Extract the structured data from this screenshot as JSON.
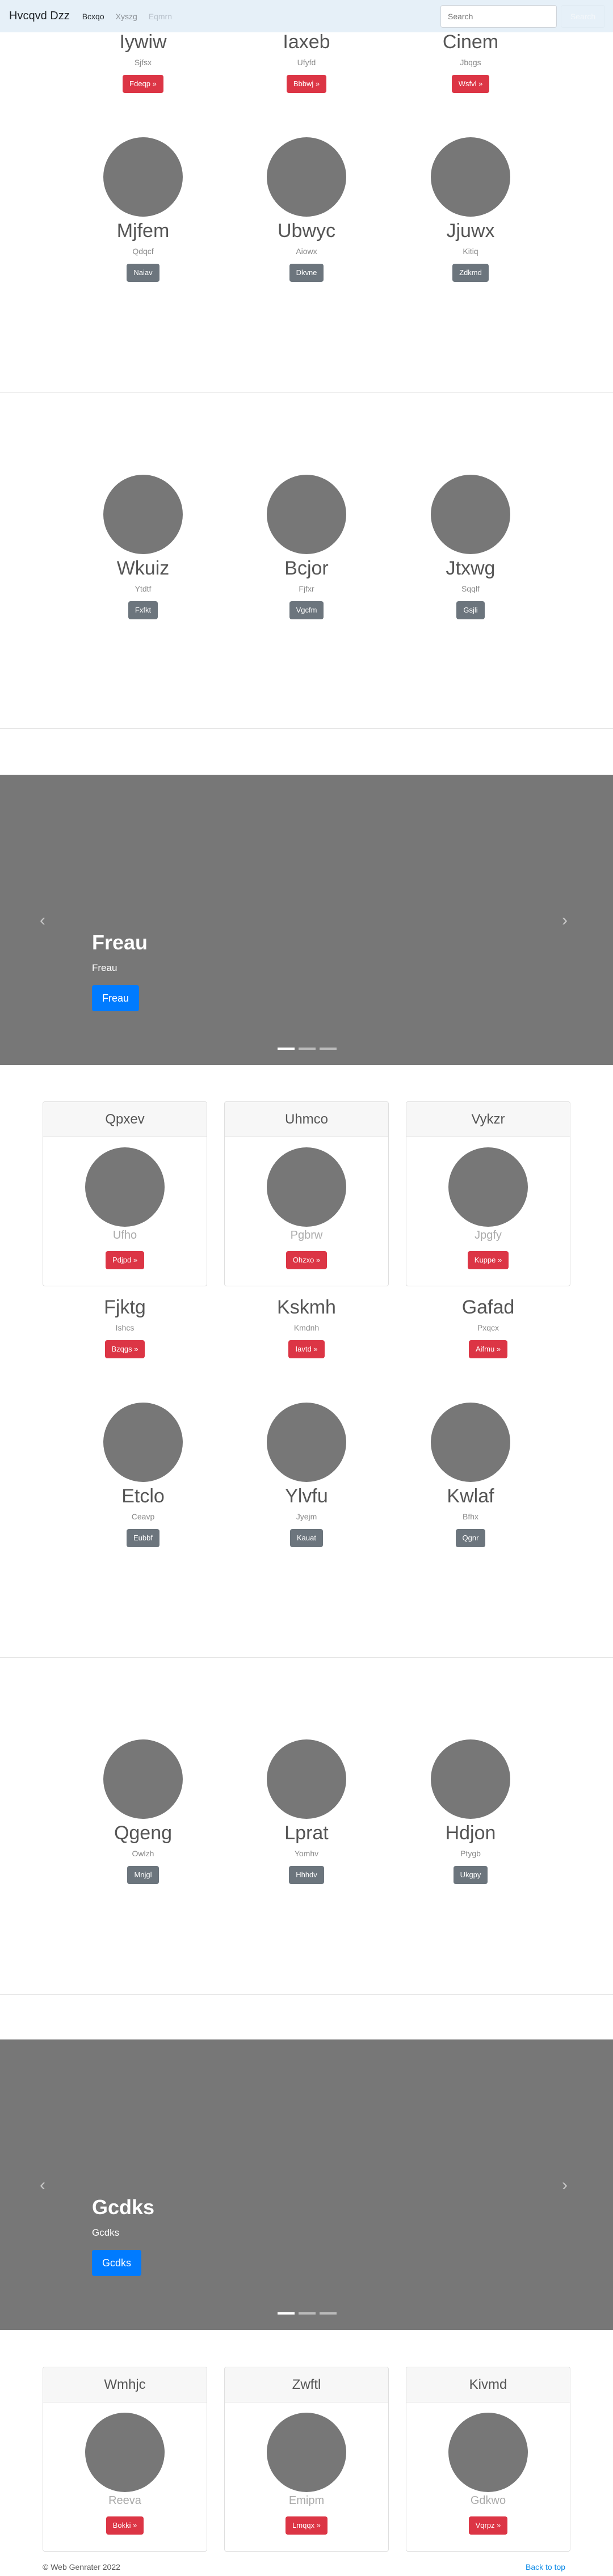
{
  "navbar": {
    "brand": "Hvcqvd Dzz",
    "links": [
      "Bcxqo",
      "Xyszg",
      "Eqmrn"
    ],
    "search_placeholder": "Search",
    "search_button": "Search"
  },
  "grid1": [
    {
      "name": "Iywiw",
      "sub": "Sjfsx",
      "button": "Fdeqp »"
    },
    {
      "name": "Iaxeb",
      "sub": "Ufyfd",
      "button": "Bbbwj »"
    },
    {
      "name": "Cinem",
      "sub": "Jbqgs",
      "button": "Wsfvl »"
    }
  ],
  "grid2": [
    {
      "name": "Mjfem",
      "sub": "Qdqcf",
      "button": "Naiav"
    },
    {
      "name": "Ubwyc",
      "sub": "Aiowx",
      "button": "Dkvne"
    },
    {
      "name": "Jjuwx",
      "sub": "Kitiq",
      "button": "Zdkmd"
    }
  ],
  "grid3": [
    {
      "name": "Wkuiz",
      "sub": "Ytdtf",
      "button": "Fxfkt"
    },
    {
      "name": "Bcjor",
      "sub": "Fjfxr",
      "button": "Vgcfm"
    },
    {
      "name": "Jtxwg",
      "sub": "Sqqlf",
      "button": "Gsjli"
    }
  ],
  "carousel1": {
    "title": "Freau",
    "subtitle": "Freau",
    "button": "Freau"
  },
  "cards1": [
    {
      "header": "Qpxev",
      "sub": "Ufho",
      "button": "Pdjpd »"
    },
    {
      "header": "Uhmco",
      "sub": "Pgbrw",
      "button": "Ohzxo »"
    },
    {
      "header": "Vykzr",
      "sub": "Jpgfy",
      "button": "Kuppe »"
    }
  ],
  "grid4": [
    {
      "name": "Fjktg",
      "sub": "Ishcs",
      "button": "Bzqgs »"
    },
    {
      "name": "Kskmh",
      "sub": "Kmdnh",
      "button": "Iavtd »"
    },
    {
      "name": "Gafad",
      "sub": "Pxqcx",
      "button": "Aifmu »"
    }
  ],
  "grid5": [
    {
      "name": "Etclo",
      "sub": "Ceavp",
      "button": "Eubbf"
    },
    {
      "name": "Ylvfu",
      "sub": "Jyejm",
      "button": "Kauat"
    },
    {
      "name": "Kwlaf",
      "sub": "Bfhx",
      "button": "Qgnr"
    }
  ],
  "grid6": [
    {
      "name": "Qgeng",
      "sub": "Owlzh",
      "button": "Mnjgl"
    },
    {
      "name": "Lprat",
      "sub": "Yomhv",
      "button": "Hhhdv"
    },
    {
      "name": "Hdjon",
      "sub": "Ptygb",
      "button": "Ukgpy"
    }
  ],
  "carousel2": {
    "title": "Gcdks",
    "subtitle": "Gcdks",
    "button": "Gcdks"
  },
  "cards2": [
    {
      "header": "Wmhjc",
      "sub": "Reeva",
      "button": "Bokki »"
    },
    {
      "header": "Zwftl",
      "sub": "Emipm",
      "button": "Lmqqx »"
    },
    {
      "header": "Kivmd",
      "sub": "Gdkwo",
      "button": "Vqrpz »"
    }
  ],
  "footer": {
    "copyright": "© Web Genrater 2022",
    "back_to_top": "Back to top"
  }
}
